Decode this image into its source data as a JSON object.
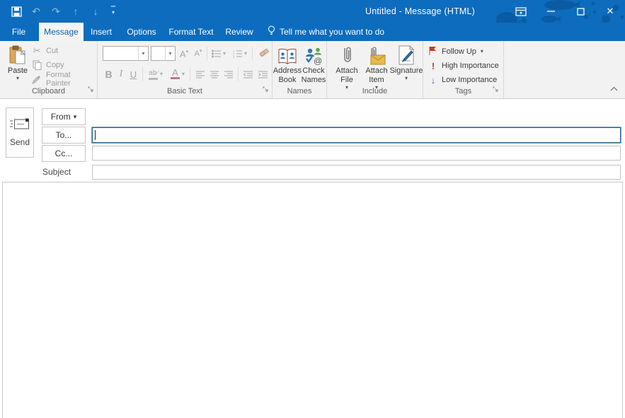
{
  "window": {
    "title": "Untitled  -  Message (HTML)"
  },
  "qat_icons": [
    "save-icon",
    "undo-icon",
    "redo-icon",
    "previous-item-icon",
    "next-item-icon",
    "customize-qat-icon"
  ],
  "icons": {
    "undo": "↶",
    "redo": "↷",
    "previous": "↑",
    "next": "↓",
    "caret_down": "▾",
    "close": "✕",
    "scissors": "✂",
    "overline": "▔"
  },
  "tabs": {
    "items": [
      {
        "label": "File"
      },
      {
        "label": "Message"
      },
      {
        "label": "Insert"
      },
      {
        "label": "Options"
      },
      {
        "label": "Format Text"
      },
      {
        "label": "Review"
      }
    ],
    "active": "Message",
    "tellme": "Tell me what you want to do"
  },
  "ribbon": {
    "clipboard": {
      "label": "Clipboard",
      "paste": "Paste",
      "cut": "Cut",
      "copy": "Copy",
      "format_painter": "Format Painter"
    },
    "basic_text": {
      "label": "Basic Text",
      "font_value": "",
      "size_value": "",
      "bold_glyph": "B",
      "italic_glyph": "I",
      "underline_glyph": "U",
      "grow_glyph": "A",
      "shrink_glyph": "A",
      "highlight_glyph": "ab",
      "font_color_glyph": "A"
    },
    "names": {
      "label": "Names",
      "address_book": "Address Book",
      "check_names": "Check Names"
    },
    "include": {
      "label": "Include",
      "attach_file": "Attach File",
      "attach_item": "Attach Item",
      "signature": "Signature"
    },
    "tags": {
      "label": "Tags",
      "follow_up": "Follow Up",
      "high_importance": "High Importance",
      "low_importance": "Low Importance",
      "high_glyph": "!",
      "low_glyph": "↓"
    }
  },
  "composer": {
    "send_label": "Send",
    "from_label": "From",
    "to_label": "To...",
    "cc_label": "Cc...",
    "subject_label": "Subject",
    "to_value": "",
    "cc_value": "",
    "subject_value": "",
    "body_value": ""
  },
  "colors": {
    "titlebar_blue": "#0d6cbd",
    "decoration_blue": "#0a5ba3",
    "active_tab_text": "#0a64ae",
    "ribbon_bg": "#f2f2f2",
    "focus_border": "#2c6488",
    "flag_red": "#c63d1d",
    "high_importance_red": "#c0392b",
    "low_importance_blue": "#3572b0",
    "paste_clipboard_tan": "#d9a75c",
    "attach_envelope_yellow": "#e6b94e"
  }
}
